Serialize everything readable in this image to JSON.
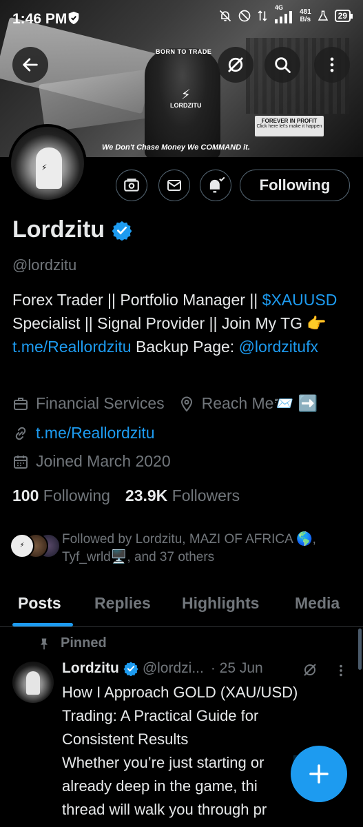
{
  "status_bar": {
    "time": "1:46 PM",
    "network": "4G",
    "net_speed_value": "481",
    "net_speed_unit": "B/s",
    "battery": "29"
  },
  "banner": {
    "born_to_trade": "BORN TO TRADE",
    "logo_text": "LORDZITU",
    "forever_title": "FOREVER IN PROFIT",
    "forever_sub": "Click here let's make it happen",
    "tagline": "We Don't Chase Money We COMMAND it."
  },
  "profile": {
    "name": "Lordzitu",
    "handle": "@lordzitu",
    "follow_label": "Following",
    "bio": {
      "line1": "Forex Trader || Portfolio Manager || ",
      "cashtag": "$XAUUSD",
      "line2": " Specialist || Signal Provider || Join My TG 👉 ",
      "tg_link": "t.me/Reallordzitu",
      "line3": " Backup Page: ",
      "backup_mention": "@lordzitufx"
    },
    "category": "Financial Services",
    "location": "Reach Me📨 ➡️",
    "website": "t.me/Reallordzitu",
    "joined": "Joined March 2020",
    "following_count": "100",
    "following_label": "Following",
    "followers_count": "23.9K",
    "followers_label": "Followers",
    "followed_by": "Followed by Lordzitu, MAZI OF AFRICA 🌎, Tyf_wrld🖥️, and 37 others"
  },
  "tabs": [
    {
      "label": "Posts",
      "active": true
    },
    {
      "label": "Replies",
      "active": false
    },
    {
      "label": "Highlights",
      "active": false
    },
    {
      "label": "Media",
      "active": false
    }
  ],
  "pinned_post": {
    "pinned_label": "Pinned",
    "author": "Lordzitu",
    "handle": "@lordzi...",
    "date": "· 25 Jun",
    "text_lines": [
      "How I Approach GOLD (XAU/USD)",
      "Trading: A Practical Guide for",
      "Consistent Results",
      "Whether you’re just starting or",
      "already deep in the game, thi",
      "thread will walk you through pr"
    ]
  },
  "colors": {
    "background": "#000000",
    "primary_text": "#e7e9ea",
    "secondary_text": "#71767b",
    "accent": "#1d9bf0",
    "border": "#536471"
  },
  "icons": {
    "back": "arrow-left-icon",
    "grok": "grok-icon",
    "search": "search-icon",
    "more": "more-vertical-icon",
    "subscriptions": "money-icon",
    "message": "envelope-icon",
    "notifications": "bell-check-icon",
    "verified": "verified-badge-icon",
    "category": "briefcase-icon",
    "location": "location-pin-icon",
    "website": "link-icon",
    "joined": "calendar-icon",
    "pinned": "pin-icon",
    "compose": "plus-icon"
  }
}
